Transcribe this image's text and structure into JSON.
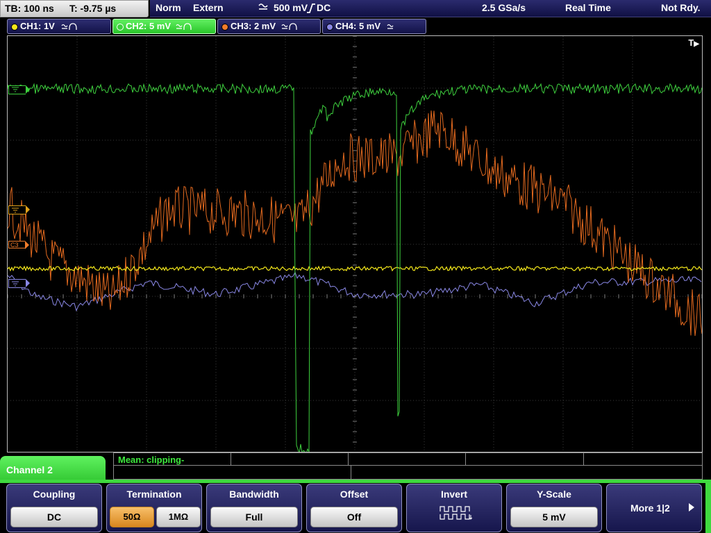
{
  "timebase": {
    "tb": "TB: 100 ns",
    "t": "T: -9.75 µs"
  },
  "status": {
    "mode": "Norm",
    "trigger": "Extern",
    "trigger_level": "500 mV",
    "trigger_coupling": "DC",
    "sample_rate": "2.5 GSa/s",
    "acq_mode": "Real Time",
    "state": "Not Rdy."
  },
  "channels": [
    {
      "label": "CH1: 1V",
      "color": "#f2e61b",
      "active": false
    },
    {
      "label": "CH2: 5 mV",
      "color": "#3ed13e",
      "active": true
    },
    {
      "label": "CH3: 2 mV",
      "color": "#f07b2a",
      "active": false
    },
    {
      "label": "CH4: 5 mV",
      "color": "#8a88e6",
      "active": false
    }
  ],
  "markers": {
    "c3": "C3"
  },
  "trigger_marker": {
    "label": "T"
  },
  "channel_tab": "Channel 2",
  "measurement": {
    "text": "Mean: clipping-"
  },
  "softkeys": {
    "coupling": {
      "title": "Coupling",
      "value": "DC"
    },
    "termination": {
      "title": "Termination",
      "opt1": "50Ω",
      "opt2": "1MΩ"
    },
    "bandwidth": {
      "title": "Bandwidth",
      "value": "Full"
    },
    "offset": {
      "title": "Offset",
      "value": "Off"
    },
    "invert": {
      "title": "Invert"
    },
    "yscale": {
      "title": "Y-Scale",
      "value": "5 mV"
    },
    "more": {
      "label": "More 1|2"
    }
  }
}
